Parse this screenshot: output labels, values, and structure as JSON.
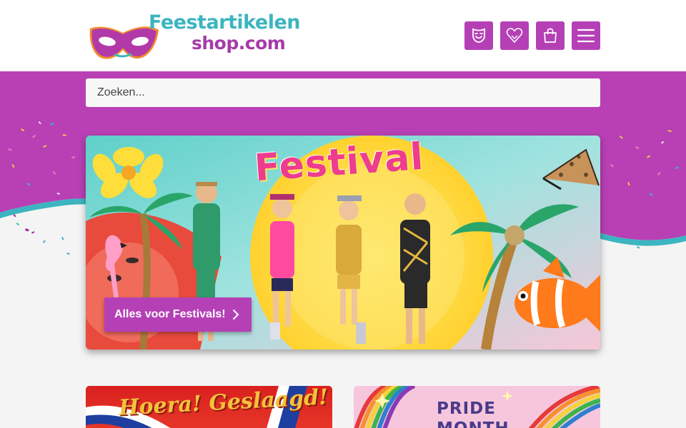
{
  "header": {
    "logo": {
      "line1": "Feestartikelen",
      "line2": "shop.com"
    },
    "buttons": [
      {
        "icon": "mask-smile-icon",
        "name": "costume-button"
      },
      {
        "icon": "heart-icon",
        "name": "wishlist-button"
      },
      {
        "icon": "shopping-bag-icon",
        "name": "cart-button"
      },
      {
        "icon": "hamburger-menu-icon",
        "name": "menu-button"
      }
    ]
  },
  "search": {
    "placeholder": "Zoeken...",
    "value": ""
  },
  "hero": {
    "title": "Festival",
    "cta_label": "Alles voor Festivals!"
  },
  "cards": [
    {
      "title": "Hoera! Geslaagd!"
    },
    {
      "title": "PRIDE\nMONTH"
    }
  ],
  "colors": {
    "brand_purple": "#b540b6",
    "brand_teal": "#3cb5c0",
    "band_purple": "#b840b4"
  }
}
